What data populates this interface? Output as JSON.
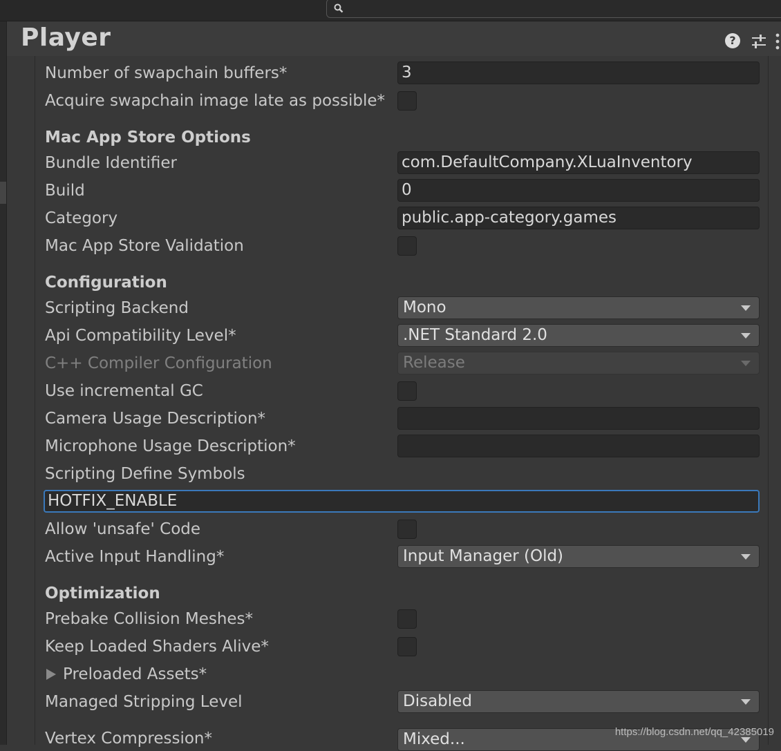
{
  "title": "Player",
  "header": {
    "help_icon": "help-icon",
    "settings_icon": "settings-icon",
    "more_icon": "more-icon"
  },
  "search": {
    "placeholder": ""
  },
  "rows": {
    "swapchain_buffers": {
      "label": "Number of swapchain buffers*",
      "value": "3"
    },
    "acquire_swapchain": {
      "label": "Acquire swapchain image late as possible*",
      "checked": false
    },
    "mac_section": "Mac App Store Options",
    "bundle_identifier": {
      "label": "Bundle Identifier",
      "value": "com.DefaultCompany.XLuaInventory"
    },
    "build": {
      "label": "Build",
      "value": "0"
    },
    "category": {
      "label": "Category",
      "value": "public.app-category.games"
    },
    "mac_validation": {
      "label": "Mac App Store Validation",
      "checked": false
    },
    "configuration_section": "Configuration",
    "scripting_backend": {
      "label": "Scripting Backend",
      "value": "Mono"
    },
    "api_level": {
      "label": "Api Compatibility Level*",
      "value": ".NET Standard 2.0"
    },
    "cpp_compiler": {
      "label": "C++ Compiler Configuration",
      "value": "Release",
      "disabled": true
    },
    "incremental_gc": {
      "label": "Use incremental GC",
      "checked": false
    },
    "camera_usage": {
      "label": "Camera Usage Description*",
      "value": ""
    },
    "microphone_usage": {
      "label": "Microphone Usage Description*",
      "value": ""
    },
    "define_symbols": {
      "label": "Scripting Define Symbols",
      "value": "HOTFIX_ENABLE"
    },
    "unsafe_code": {
      "label": "Allow 'unsafe' Code",
      "checked": false
    },
    "input_handling": {
      "label": "Active Input Handling*",
      "value": "Input Manager (Old)"
    },
    "optimization_section": "Optimization",
    "prebake_collision": {
      "label": "Prebake Collision Meshes*",
      "checked": false
    },
    "keep_shaders": {
      "label": "Keep Loaded Shaders Alive*",
      "checked": false
    },
    "preloaded_assets": {
      "label": "Preloaded Assets*"
    },
    "stripping_level": {
      "label": "Managed Stripping Level",
      "value": "Disabled"
    },
    "vertex_compression": {
      "label": "Vertex Compression*",
      "value": "Mixed..."
    }
  },
  "watermark": "https://blog.csdn.net/qq_42385019",
  "colors": {
    "background": "#383838",
    "field_bg": "#2a2a2a",
    "focus_border": "#3a79bb",
    "dropdown_bg": "#515151"
  }
}
